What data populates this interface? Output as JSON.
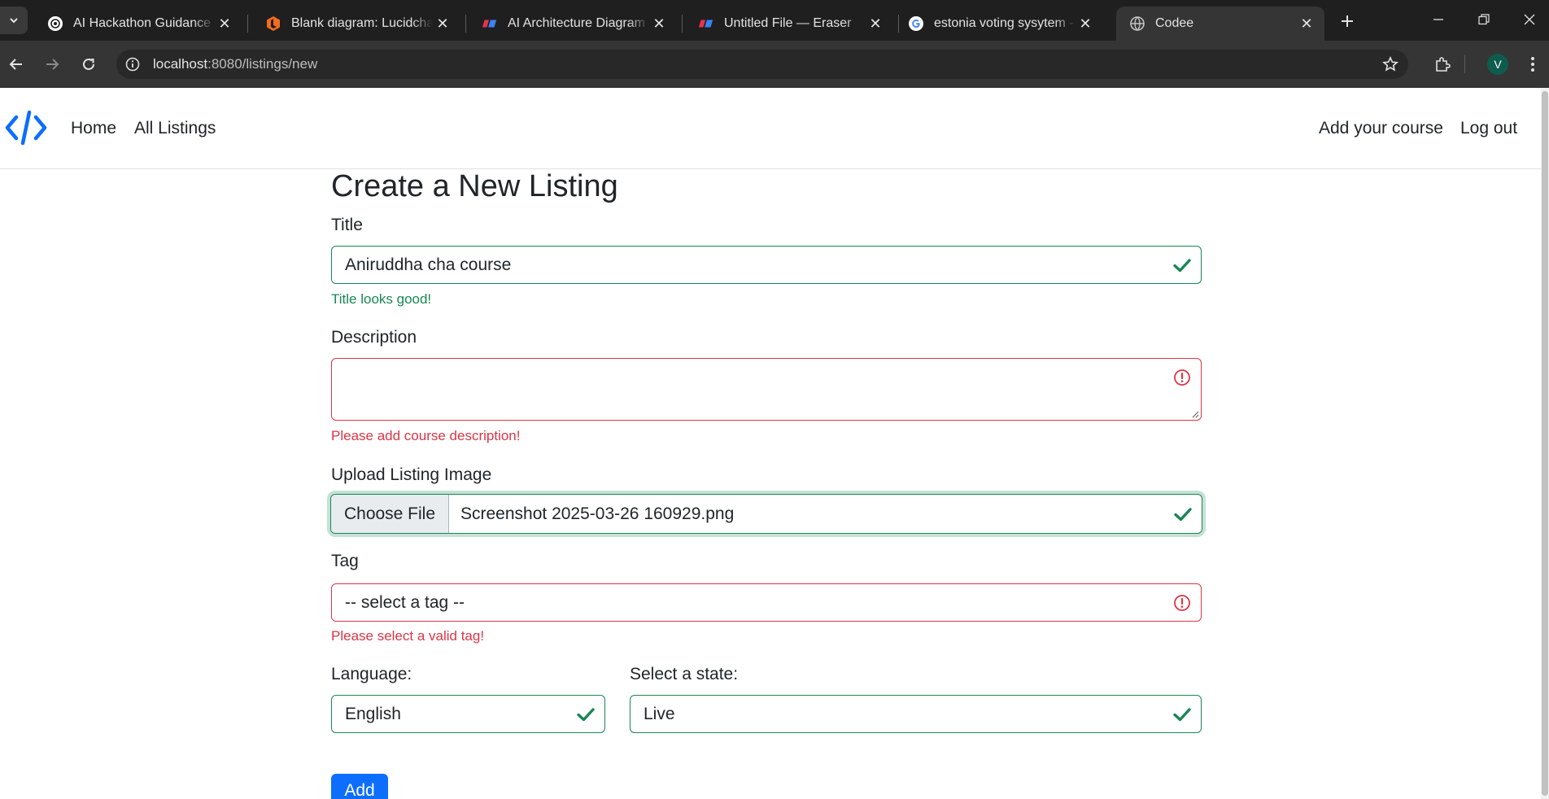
{
  "browser": {
    "tabs": [
      {
        "title": "AI Hackathon Guidance Ne",
        "favicon": "openai-icon"
      },
      {
        "title": "Blank diagram: Lucidchart",
        "favicon": "lucidchart-icon"
      },
      {
        "title": "AI Architecture Diagram Ge",
        "favicon": "eraser-icon"
      },
      {
        "title": "Untitled File — Eraser",
        "favicon": "eraser-icon"
      },
      {
        "title": "estonia voting sysytem - G",
        "favicon": "google-icon"
      },
      {
        "title": "Codee",
        "favicon": "globe-icon"
      }
    ],
    "active_tab_index": 5,
    "url_host": "localhost",
    "url_rest": ":8080/listings/new",
    "profile_initial": "V"
  },
  "navbar": {
    "brand_icon": "code-brackets-icon",
    "left_links": [
      "Home",
      "All Listings"
    ],
    "right_links": [
      "Add your course",
      "Log out"
    ]
  },
  "form": {
    "heading": "Create a New Listing",
    "title": {
      "label": "Title",
      "value": "Aniruddha cha course",
      "status": "valid",
      "feedback": "Title looks good!"
    },
    "description": {
      "label": "Description",
      "value": "",
      "status": "invalid",
      "feedback": "Please add course description!"
    },
    "image": {
      "label": "Upload Listing Image",
      "button_label": "Choose File",
      "file_name": "Screenshot 2025-03-26 160929.png",
      "status": "valid"
    },
    "tag": {
      "label": "Tag",
      "selected": "-- select a tag --",
      "status": "invalid",
      "feedback": "Please select a valid tag!"
    },
    "language": {
      "label": "Language:",
      "selected": "English",
      "status": "valid"
    },
    "state": {
      "label": "Select a state:",
      "selected": "Live",
      "status": "valid"
    },
    "submit_label": "Add"
  },
  "colors": {
    "valid": "#198754",
    "invalid": "#dc3545",
    "primary": "#0d6efd",
    "brand": "#0d6efd"
  }
}
